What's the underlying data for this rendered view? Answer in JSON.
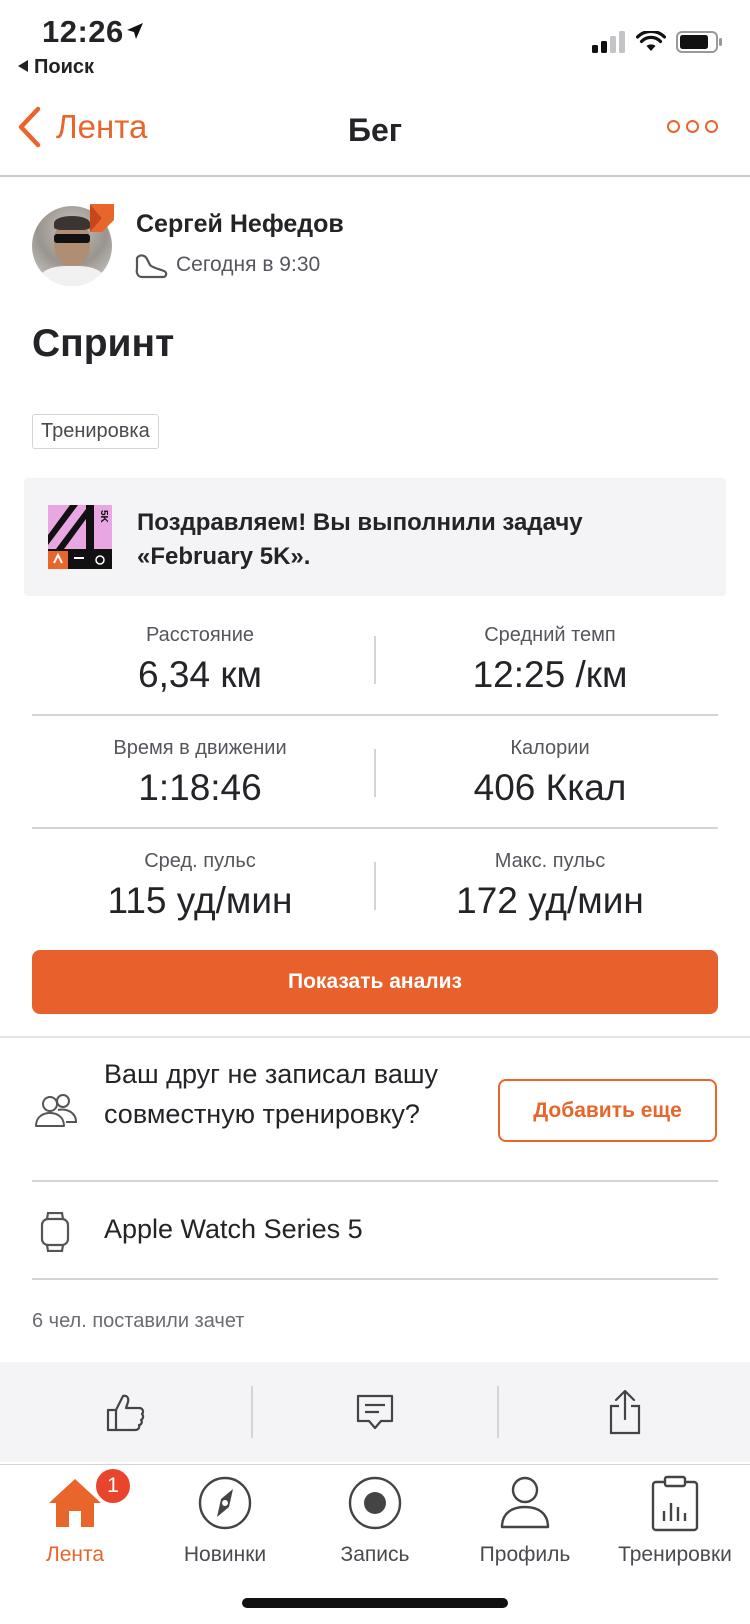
{
  "status_bar": {
    "time": "12:26",
    "back_app": "Поиск"
  },
  "nav": {
    "back_label": "Лента",
    "title": "Бег"
  },
  "athlete": {
    "name": "Сергей Нефедов",
    "activity_time": "Сегодня в 9:30"
  },
  "activity": {
    "title": "Спринт",
    "tag": "Тренировка",
    "challenge": {
      "badge_text": "5K",
      "message": "Поздравляем! Вы выполнили задачу «February 5K»."
    }
  },
  "stats": [
    {
      "label": "Расстояние",
      "value": "6,34 км"
    },
    {
      "label": "Средний темп",
      "value": "12:25 /км"
    },
    {
      "label": "Время в движении",
      "value": "1:18:46"
    },
    {
      "label": "Калории",
      "value": "406 Ккал"
    },
    {
      "label": "Сред. пульс",
      "value": "115 уд/мин"
    },
    {
      "label": "Макс. пульс",
      "value": "172 уд/мин"
    }
  ],
  "analysis_button": "Показать анализ",
  "friend_prompt": {
    "text": "Ваш друг не записал вашу совместную тренировку?",
    "button": "Добавить еще"
  },
  "device": {
    "name": "Apple Watch Series 5"
  },
  "kudos": {
    "text": "6 чел. поставили зачет"
  },
  "tabbar": {
    "badge_count": "1",
    "tabs": [
      {
        "label": "Лента",
        "icon": "home-icon",
        "active": true
      },
      {
        "label": "Новинки",
        "icon": "compass-icon",
        "active": false
      },
      {
        "label": "Запись",
        "icon": "record-icon",
        "active": false
      },
      {
        "label": "Профиль",
        "icon": "profile-icon",
        "active": false
      },
      {
        "label": "Тренировки",
        "icon": "training-log-icon",
        "active": false
      }
    ]
  },
  "colors": {
    "accent": "#E8652B",
    "button": "#E8612C",
    "badge": "#E8452C"
  }
}
